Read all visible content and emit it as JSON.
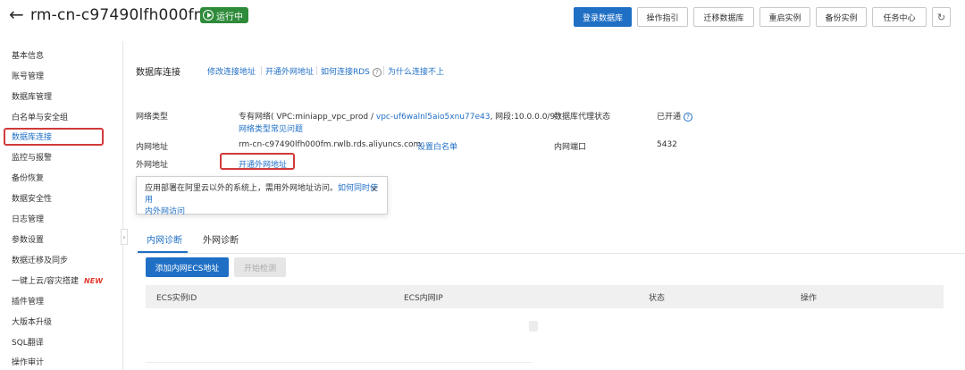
{
  "header": {
    "back_icon": "arrow-left-icon",
    "title": "rm-cn-c97490lfh000fm",
    "status": "运行中",
    "status_color": "#2e8b3a",
    "buttons": {
      "login_db": "登录数据库",
      "guide": "操作指引",
      "migrate": "迁移数据库",
      "restart": "重启实例",
      "backup": "备份实例",
      "tasks": "任务中心"
    },
    "refresh_icon": "refresh-icon"
  },
  "sidebar": {
    "items": [
      {
        "label": "基本信息"
      },
      {
        "label": "账号管理"
      },
      {
        "label": "数据库管理"
      },
      {
        "label": "白名单与安全组"
      },
      {
        "label": "数据库连接"
      },
      {
        "label": "监控与报警"
      },
      {
        "label": "备份恢复"
      },
      {
        "label": "数据安全性"
      },
      {
        "label": "日志管理"
      },
      {
        "label": "参数设置"
      },
      {
        "label": "数据迁移及同步"
      },
      {
        "label": "一键上云/容灾搭建",
        "tag": "NEW"
      },
      {
        "label": "插件管理"
      },
      {
        "label": "大版本升级"
      },
      {
        "label": "SQL翻译"
      },
      {
        "label": "操作审计"
      }
    ],
    "active_index": 4
  },
  "main": {
    "section_title": "数据库连接",
    "top_links": {
      "modify": "修改连接地址",
      "open_public": "开通外网地址",
      "how_connect": "如何连接RDS",
      "why_fail": "为什么连接不上"
    },
    "info": {
      "network_type_label": "网络类型",
      "network_type_value": "专有网络( VPC:miniapp_vpc_prod / ",
      "vpc_id": "vpc-uf6walnl5aio5xnu77e43",
      "network_segment": ", 网段:10.0.0.0/9 )",
      "network_faq": "网络类型常见问题",
      "proxy_label": "数据库代理状态",
      "proxy_value": "已开通",
      "intranet_label": "内网地址",
      "intranet_value": "rm-cn-c97490lfh000fm.rwlb.rds.aliyuncs.com",
      "whitelist_link": "设置白名单",
      "intranet_port_label": "内网端口",
      "intranet_port_value": "5432",
      "public_label": "外网地址",
      "public_link": "开通外网地址"
    },
    "tooltip": {
      "text": "应用部署在阿里云以外的系统上，需用外网地址访问。",
      "link_a": "如何同时使用",
      "link_b": "内外网访问",
      "close_icon": "close-icon"
    },
    "tabs": [
      {
        "label": "内网诊断"
      },
      {
        "label": "外网诊断"
      }
    ],
    "actions": {
      "add_ecs": "添加内网ECS地址",
      "start_detect": "开始检测"
    },
    "table": {
      "columns": [
        "ECS实例ID",
        "ECS内网IP",
        "状态",
        "操作"
      ]
    }
  }
}
